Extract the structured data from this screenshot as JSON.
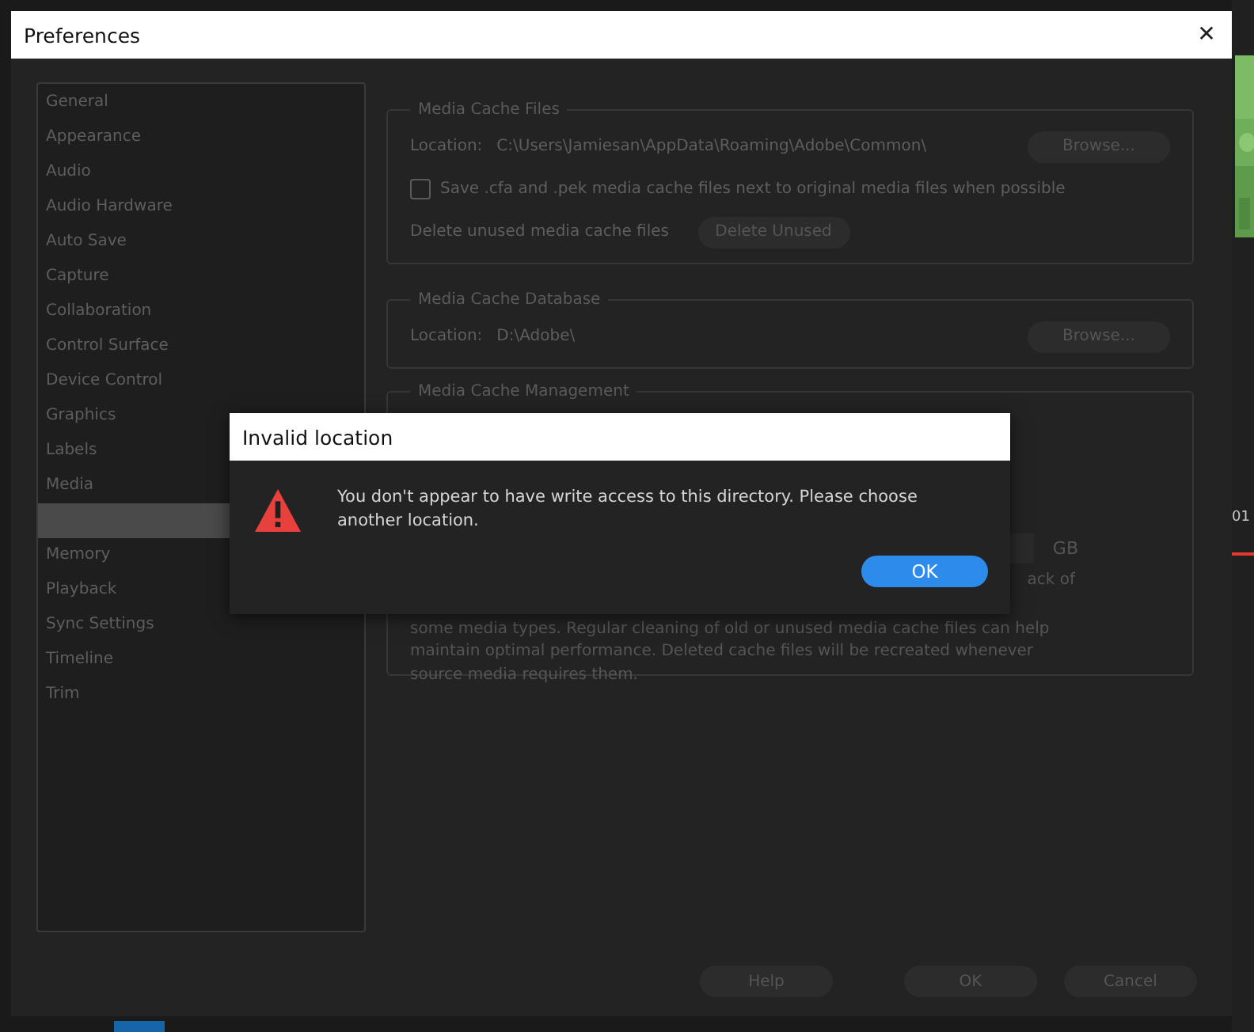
{
  "background": {
    "timecode": "01"
  },
  "window": {
    "title": "Preferences",
    "close": "✕"
  },
  "sidebar": {
    "items": [
      {
        "label": "General",
        "selected": false
      },
      {
        "label": "Appearance",
        "selected": false
      },
      {
        "label": "Audio",
        "selected": false
      },
      {
        "label": "Audio Hardware",
        "selected": false
      },
      {
        "label": "Auto Save",
        "selected": false
      },
      {
        "label": "Capture",
        "selected": false
      },
      {
        "label": "Collaboration",
        "selected": false
      },
      {
        "label": "Control Surface",
        "selected": false
      },
      {
        "label": "Device Control",
        "selected": false
      },
      {
        "label": "Graphics",
        "selected": false
      },
      {
        "label": "Labels",
        "selected": false
      },
      {
        "label": "Media",
        "selected": false
      },
      {
        "selected": true
      },
      {
        "label": "Memory",
        "selected": false
      },
      {
        "label": "Playback",
        "selected": false
      },
      {
        "label": "Sync Settings",
        "selected": false
      },
      {
        "label": "Timeline",
        "selected": false
      },
      {
        "label": "Trim",
        "selected": false
      }
    ]
  },
  "media_cache_files": {
    "title": "Media Cache Files",
    "location_label": "Location:",
    "location": "C:\\Users\\Jamiesan\\AppData\\Roaming\\Adobe\\Common\\",
    "browse": "Browse...",
    "save_next_to_originals": {
      "label": "Save .cfa and .pek media cache files next to original media files when possible",
      "checked": false
    },
    "delete_label": "Delete unused media cache files",
    "delete_button": "Delete Unused"
  },
  "media_cache_database": {
    "title": "Media Cache Database",
    "location_label": "Location:",
    "location": "D:\\Adobe\\",
    "browse": "Browse..."
  },
  "media_cache_management": {
    "title": "Media Cache Management",
    "unit": "GB",
    "description_lines": [
      "ack of",
      "some media types. Regular cleaning of old or unused media cache files can help",
      "maintain optimal performance. Deleted cache files will be recreated whenever",
      "source media requires them."
    ]
  },
  "buttons": [
    {
      "label": "Help",
      "kind": "help"
    },
    {
      "label": "OK",
      "kind": "ok"
    },
    {
      "label": "Cancel",
      "kind": "cancel"
    }
  ],
  "alert": {
    "title": "Invalid location",
    "message": "You don't appear to have write access to this directory. Please choose another location.",
    "button": "OK"
  }
}
